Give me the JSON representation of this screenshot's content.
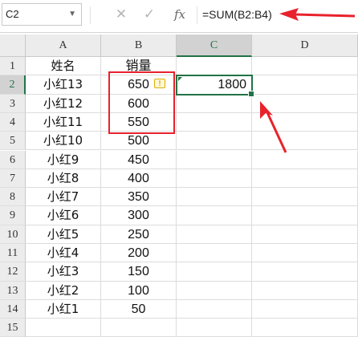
{
  "formula_bar": {
    "name_box": "C2",
    "cancel_icon": "✕",
    "enter_icon": "✓",
    "insert_function_label": "fx",
    "formula": "=SUM(B2:B4)"
  },
  "columns": [
    "A",
    "B",
    "C",
    "D"
  ],
  "selected_column": "C",
  "rows": [
    {
      "num": "1",
      "a": "姓名",
      "b": "销量"
    },
    {
      "num": "2",
      "a": "小红13",
      "b": "650"
    },
    {
      "num": "3",
      "a": "小红12",
      "b": "600"
    },
    {
      "num": "4",
      "a": "小红11",
      "b": "550"
    },
    {
      "num": "5",
      "a": "小红10",
      "b": "500"
    },
    {
      "num": "6",
      "a": "小红9",
      "b": "450"
    },
    {
      "num": "7",
      "a": "小红8",
      "b": "400"
    },
    {
      "num": "8",
      "a": "小红7",
      "b": "350"
    },
    {
      "num": "9",
      "a": "小红6",
      "b": "300"
    },
    {
      "num": "10",
      "a": "小红5",
      "b": "250"
    },
    {
      "num": "11",
      "a": "小红4",
      "b": "200"
    },
    {
      "num": "12",
      "a": "小红3",
      "b": "150"
    },
    {
      "num": "13",
      "a": "小红2",
      "b": "100"
    },
    {
      "num": "14",
      "a": "小红1",
      "b": "50"
    },
    {
      "num": "15",
      "a": "",
      "b": ""
    }
  ],
  "active_cell": {
    "ref": "C2",
    "value": "1800"
  },
  "annotation_color": "#e8222c",
  "accent_color": "#217346"
}
